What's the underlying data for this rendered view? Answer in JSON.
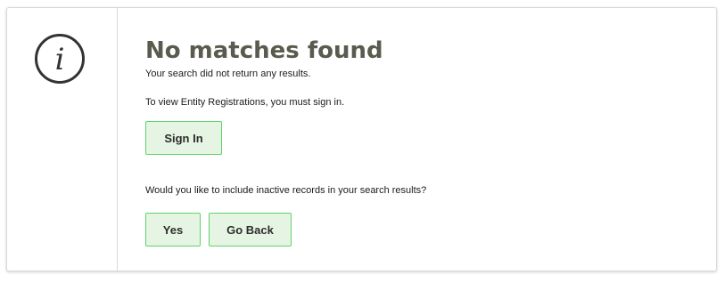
{
  "message": {
    "title": "No matches found",
    "subtitle": "Your search did not return any results.",
    "signin_prompt": "To view Entity Registrations, you must sign in.",
    "inactive_prompt": "Would you like to include inactive records in your search results?"
  },
  "buttons": {
    "signin_label": "Sign In",
    "yes_label": "Yes",
    "back_label": "Go Back"
  },
  "icon": {
    "name": "info-icon",
    "glyph": "i",
    "color": "#333333"
  },
  "colors": {
    "button_bg": "#e6f5e3",
    "button_border": "#5cd46b",
    "title": "#5a5a4e"
  }
}
